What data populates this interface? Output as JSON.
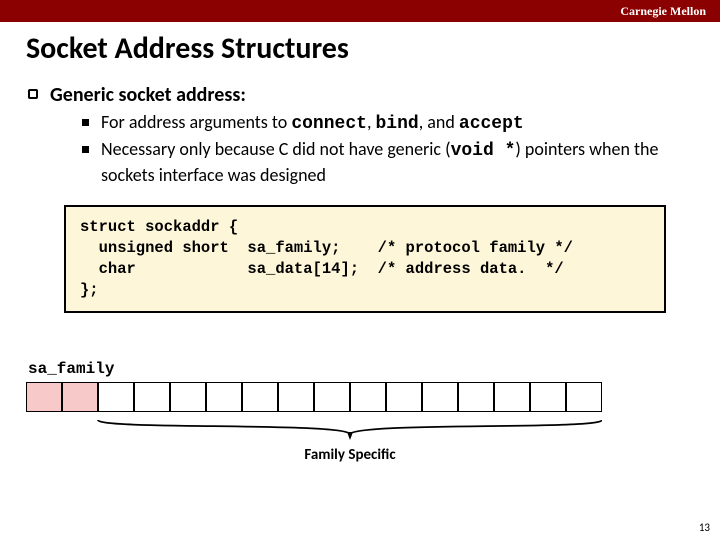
{
  "header": {
    "org": "Carnegie Mellon"
  },
  "title": "Socket Address Structures",
  "bullets": {
    "l1": "Generic socket address:",
    "sub1_pre": "For address arguments to ",
    "sub1_c1": "connect",
    "sub1_m1": ", ",
    "sub1_c2": "bind",
    "sub1_m2": ", and ",
    "sub1_c3": "accept",
    "sub2_pre": "Necessary only because C did not have generic (",
    "sub2_code": "void *",
    "sub2_post": ") pointers when the sockets interface was designed"
  },
  "code": "struct sockaddr {\n  unsigned short  sa_family;    /* protocol family */\n  char            sa_data[14];  /* address data.  */\n};",
  "diagram": {
    "sa_label": "sa_family",
    "brace_label": "Family Specific"
  },
  "pagenum": "13"
}
